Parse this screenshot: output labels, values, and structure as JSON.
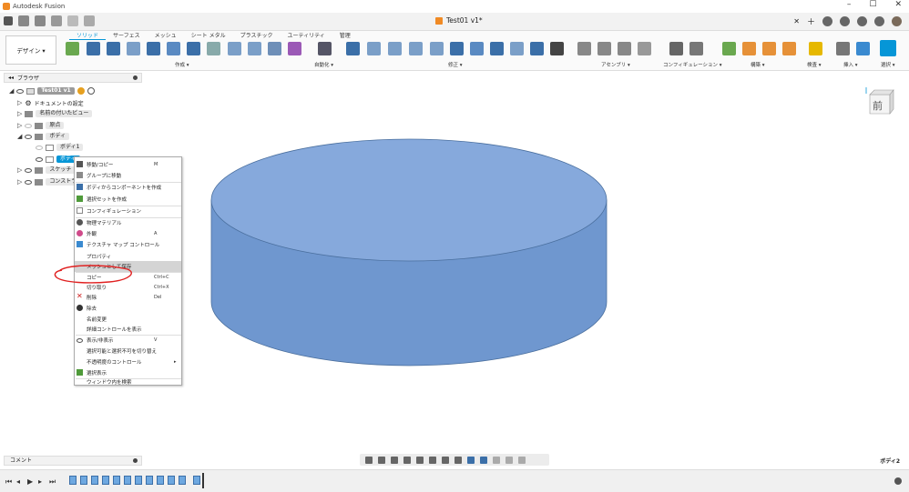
{
  "window": {
    "title": "Autodesk Fusion",
    "doc_tab": "Test01 v1*"
  },
  "ribbon": {
    "workspace": "デザイン ▾",
    "tabs": [
      "ソリッド",
      "サーフェス",
      "メッシュ",
      "シート メタル",
      "プラスチック",
      "ユーティリティ",
      "管理"
    ],
    "active_tab": 0,
    "groups": [
      {
        "label": "作成 ▾"
      },
      {
        "label": "自動化 ▾"
      },
      {
        "label": "修正 ▾"
      },
      {
        "label": "アセンブリ ▾"
      },
      {
        "label": "コンフィギュレーション ▾"
      },
      {
        "label": "構築 ▾"
      },
      {
        "label": "検査 ▾"
      },
      {
        "label": "挿入 ▾"
      },
      {
        "label": "選択 ▾"
      }
    ]
  },
  "browser": {
    "header": "ブラウザ",
    "items": [
      {
        "label": "Test01 v1"
      },
      {
        "label": "ドキュメントの設定"
      },
      {
        "label": "名前の付いたビュー"
      },
      {
        "label": "原点"
      },
      {
        "label": "ボディ"
      },
      {
        "label": "ボディ1"
      },
      {
        "label": "ボディ"
      },
      {
        "label": "スケッチ"
      },
      {
        "label": "コンストラ"
      }
    ]
  },
  "context_menu": {
    "items": [
      {
        "label": "移動/コピー",
        "shortcut": "M",
        "icon_color": "#555555"
      },
      {
        "label": "グループに移動",
        "shortcut": "",
        "icon_color": "#8a8a8a"
      },
      {
        "label": "ボディからコンポーネントを作成",
        "shortcut": "",
        "icon_color": "#3b6fa8"
      },
      {
        "label": "選択セットを作成",
        "shortcut": "",
        "icon_color": "#4f9a3a"
      },
      {
        "label": "コンフィギュレーション",
        "shortcut": "",
        "icon_color": "#888888"
      },
      {
        "label": "物理マテリアル",
        "shortcut": "",
        "icon_color": "#555555"
      },
      {
        "label": "外観",
        "shortcut": "A",
        "icon_color": "#d04a8a"
      },
      {
        "label": "テクスチャ マップ コントロール",
        "shortcut": "",
        "icon_color": "#3a8ad0"
      },
      {
        "label": "プロパティ",
        "shortcut": "",
        "icon_color": ""
      },
      {
        "label": "メッシュとして保存",
        "shortcut": "",
        "icon_color": ""
      },
      {
        "label": "コピー",
        "shortcut": "Ctrl+C",
        "icon_color": ""
      },
      {
        "label": "切り取り",
        "shortcut": "Ctrl+X",
        "icon_color": ""
      },
      {
        "label": "削除",
        "shortcut": "Del",
        "icon_color": "#d02020"
      },
      {
        "label": "除去",
        "shortcut": "",
        "icon_color": "#333333"
      },
      {
        "label": "名前変更",
        "shortcut": "",
        "icon_color": ""
      },
      {
        "label": "詳細コントロールを表示",
        "shortcut": "",
        "icon_color": ""
      },
      {
        "label": "表示/非表示",
        "shortcut": "V",
        "icon_color": "#555555"
      },
      {
        "label": "選択可能と選択不可を切り替え",
        "shortcut": "",
        "icon_color": ""
      },
      {
        "label": "不透明度のコントロール",
        "shortcut": "▸",
        "icon_color": ""
      },
      {
        "label": "選択表示",
        "shortcut": "",
        "icon_color": "#4f9a3a"
      },
      {
        "label": "ウィンドウ内を検索",
        "shortcut": "",
        "icon_color": ""
      }
    ]
  },
  "viewcube": {
    "face": "前"
  },
  "comments": {
    "label": "コメント"
  },
  "status": {
    "selection_label": "ボディ2"
  },
  "colors": {
    "accent": "#0696d7",
    "body_fill": "#7ba0d6",
    "annotation": "#e02020"
  }
}
